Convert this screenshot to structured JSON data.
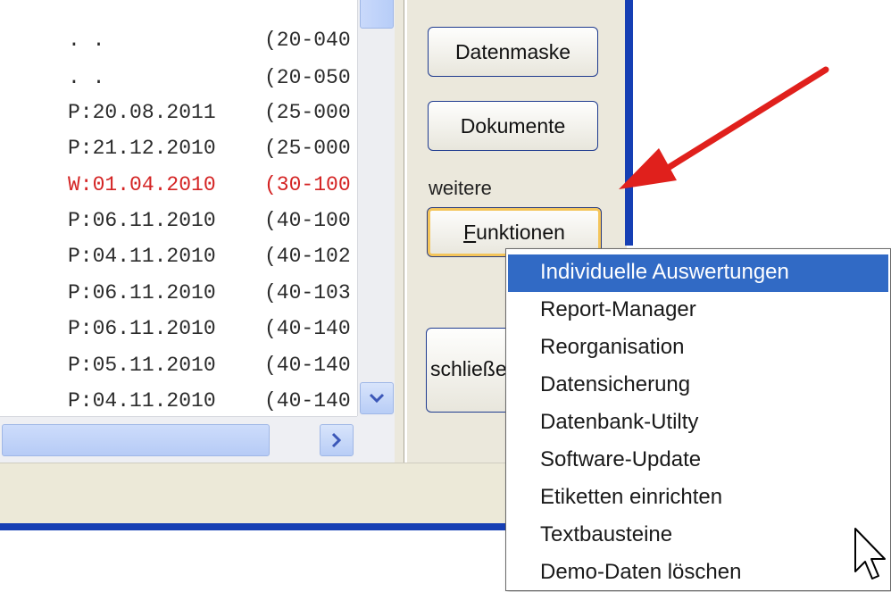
{
  "list": {
    "rows": [
      {
        "date": "  .  .    ",
        "code": "(20-040"
      },
      {
        "date": "  .  .    ",
        "code": "(20-050"
      },
      {
        "date": "P:20.08.2011",
        "code": "(25-000"
      },
      {
        "date": "P:21.12.2010",
        "code": "(25-000"
      },
      {
        "date": "W:01.04.2010",
        "code": "(30-100"
      },
      {
        "date": "P:06.11.2010",
        "code": "(40-100"
      },
      {
        "date": "P:04.11.2010",
        "code": "(40-102"
      },
      {
        "date": "P:06.11.2010",
        "code": "(40-103"
      },
      {
        "date": "P:06.11.2010",
        "code": "(40-140"
      },
      {
        "date": "P:05.11.2010",
        "code": "(40-140"
      },
      {
        "date": "P:04.11.2010",
        "code": "(40-140"
      }
    ],
    "highlight_color": "#d42424"
  },
  "buttons": {
    "datenmaske": "Datenmaske",
    "dokumente": "Dokumente",
    "funktionen_mnemonic": "F",
    "funktionen_rest": "unktionen",
    "schliessen": "schließen"
  },
  "labels": {
    "weitere": "weitere"
  },
  "menu": {
    "items": [
      {
        "label": "Individuelle Auswertungen",
        "selected": true
      },
      {
        "label": "Report-Manager",
        "selected": false
      },
      {
        "label": "Reorganisation",
        "selected": false
      },
      {
        "label": "Datensicherung",
        "selected": false
      },
      {
        "label": "Datenbank-Utilty",
        "selected": false
      },
      {
        "label": "Software-Update",
        "selected": false
      },
      {
        "label": "Etiketten einrichten",
        "selected": false
      },
      {
        "label": "Textbausteine",
        "selected": false
      },
      {
        "label": "Demo-Daten löschen",
        "selected": false
      }
    ],
    "selection_color": "#316ac5"
  },
  "annotation": {
    "arrow_color": "#e0201c"
  },
  "icons": {
    "scroll_down": "chevron-down-icon",
    "scroll_right": "chevron-right-icon",
    "cursor": "mouse-pointer-icon"
  }
}
